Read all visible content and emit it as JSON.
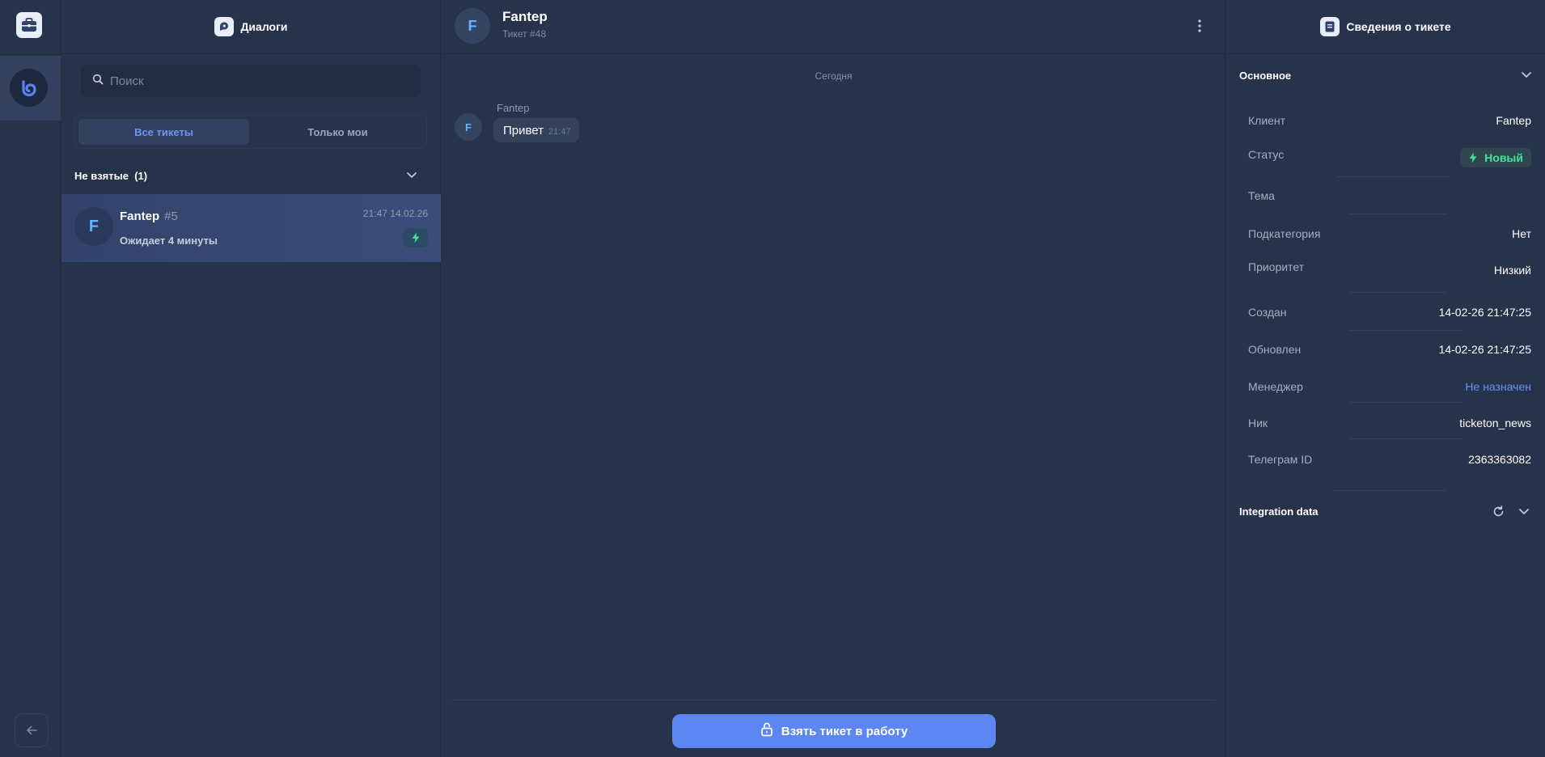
{
  "rail": {
    "logo_icon": "briefcase-icon",
    "active_item_icon": "spiral-logo-icon",
    "back_icon": "arrow-left-icon"
  },
  "dialogs": {
    "title": "Диалоги",
    "title_icon": "dialogs-icon",
    "search": {
      "placeholder": "Поиск",
      "value": ""
    },
    "tabs": [
      {
        "label": "Все тикеты",
        "active": true
      },
      {
        "label": "Только мои",
        "active": false
      }
    ],
    "group": {
      "title": "Не взятые",
      "count": "(1)"
    },
    "tickets": [
      {
        "avatar": "F",
        "name": "Fantep",
        "number": "#5",
        "time": "21:47 14.02.26",
        "waiting": "Ожидает 4 минуты",
        "status_icon": "bolt-icon"
      }
    ]
  },
  "chat": {
    "avatar": "F",
    "name": "Fantep",
    "subtitle": "Тикет #48",
    "menu_icon": "vertical-dots-icon",
    "day_label": "Сегодня",
    "messages": [
      {
        "author": "Fantep",
        "avatar": "F",
        "text": "Привет",
        "time": "21:47"
      }
    ],
    "take_button": {
      "label": "Взять тикет в работу",
      "icon": "lock-icon"
    }
  },
  "info": {
    "title": "Сведения о тикете",
    "title_icon": "ticket-info-icon",
    "main_section": "Основное",
    "fields": [
      {
        "label": "Клиент",
        "value": "Fantep"
      },
      {
        "label": "Статус",
        "value": "Новый"
      },
      {
        "label": "Тема",
        "value": ""
      },
      {
        "label": "Подкатегория",
        "value": "Нет"
      },
      {
        "label": "Приоритет",
        "value": "Низкий"
      },
      {
        "label": "Создан",
        "value": "14-02-26 21:47:25"
      },
      {
        "label": "Обновлен",
        "value": "14-02-26 21:47:25"
      },
      {
        "label": "Менеджер",
        "value": "Не назначен"
      },
      {
        "label": "Ник",
        "value": "ticketon_news"
      },
      {
        "label": "Телеграм ID",
        "value": "2363363082"
      }
    ],
    "integration_section": "Integration data"
  },
  "colors": {
    "background": "#27334a",
    "accent": "#5c86f2",
    "status_green": "#3ee59a",
    "link": "#6c93f5"
  }
}
